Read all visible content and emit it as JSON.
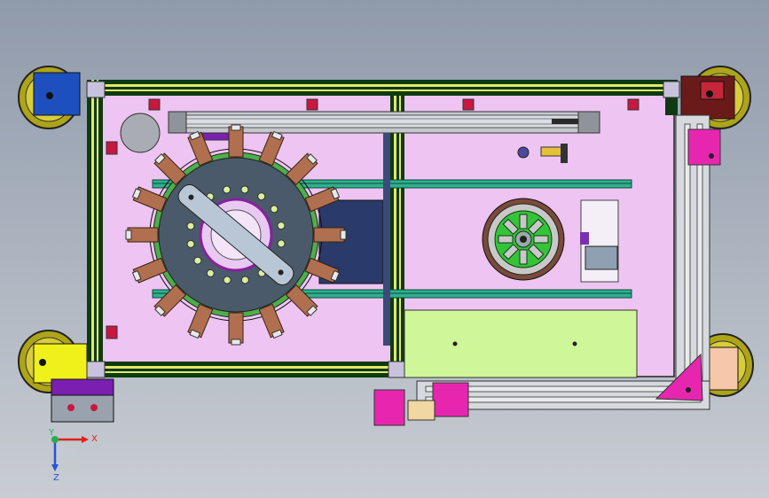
{
  "viewport": {
    "kind": "3D CAD top view (SolidWorks-style)",
    "background_top": "#8f9aab",
    "background_bottom": "#c9cdd3"
  },
  "triad": {
    "x_label": "X",
    "y_label": "Y",
    "z_label": "Z",
    "x_color": "#e0201c",
    "y_color": "#22b14c",
    "z_color": "#2a52d6"
  },
  "palette": {
    "base_plate": "#eec4f2",
    "frame_green": "#0e3a12",
    "frame_yellow": "#e3e76a",
    "rail_teal": "#2fb08f",
    "magenta_bracket": "#e726b0",
    "wood_slider": "#b07050",
    "turntable": "#4a5a6a",
    "rotor_green": "#35c33a",
    "lime_plate": "#cff79a",
    "navy_block": "#2a3a6a"
  },
  "components": {
    "frame": "aluminium-profile-frame",
    "turntable": "indexing-turntable",
    "motor": "stator-motor",
    "caster": "caster-wheel",
    "cylinder": "linear-cylinder",
    "rail": "linear-rail",
    "plate": "lime-mounting-plate"
  }
}
